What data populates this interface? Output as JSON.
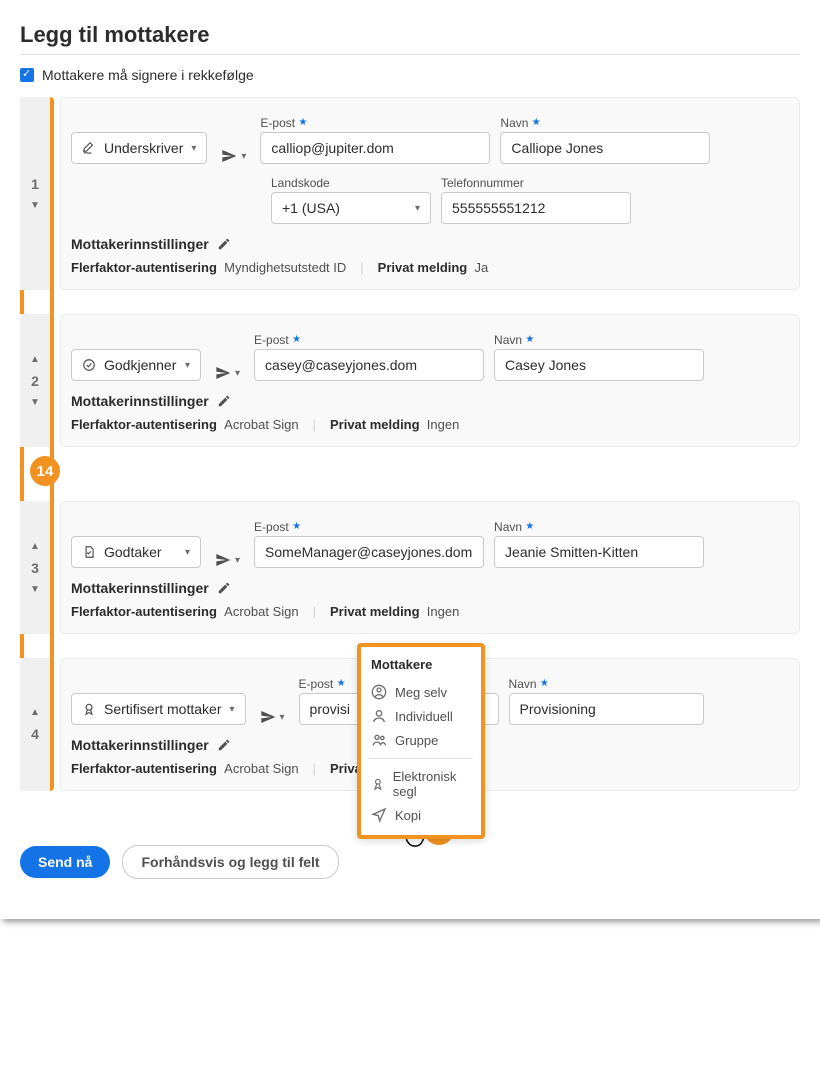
{
  "page_title": "Legg til mottakere",
  "sign_order_checkbox_label": "Mottakere må signere i rekkefølge",
  "sign_order_checked": true,
  "labels": {
    "email": "E-post",
    "name": "Navn",
    "country_code": "Landskode",
    "phone": "Telefonnummer",
    "recipient_settings": "Mottakerinnstillinger",
    "mfa": "Flerfaktor-autentisering",
    "private_msg": "Privat melding"
  },
  "roles": {
    "signer": "Underskriver",
    "approver": "Godkjenner",
    "acceptor": "Godtaker",
    "certified": "Sertifisert mottaker"
  },
  "recipients": [
    {
      "order": "1",
      "role_key": "signer",
      "email": "calliop@jupiter.dom",
      "name": "Calliope Jones",
      "country_code": "+1 (USA)",
      "phone": "555555551212",
      "mfa_value": "Myndighetsutstedt ID",
      "private_msg_value": "Ja"
    },
    {
      "order": "2",
      "role_key": "approver",
      "email": "casey@caseyjones.dom",
      "name": "Casey Jones",
      "mfa_value": "Acrobat Sign",
      "private_msg_value": "Ingen"
    },
    {
      "order": "3",
      "role_key": "acceptor",
      "email": "SomeManager@caseyjones.dom",
      "name": "Jeanie Smitten-Kitten",
      "mfa_value": "Acrobat Sign",
      "private_msg_value": "Ingen"
    },
    {
      "order": "4",
      "role_key": "certified",
      "email_partial": "provisi",
      "name": "Provisioning",
      "mfa_value": "Acrobat Sign",
      "private_msg_partial": "Privat meldi"
    }
  ],
  "popup": {
    "title": "Mottakere",
    "items": [
      {
        "icon": "user-circle",
        "label": "Meg selv"
      },
      {
        "icon": "person",
        "label": "Individuell"
      },
      {
        "icon": "group",
        "label": "Gruppe"
      }
    ],
    "items2": [
      {
        "icon": "seal",
        "label": "Elektronisk segl"
      },
      {
        "icon": "send",
        "label": "Kopi"
      }
    ]
  },
  "callouts": {
    "c13": "13",
    "c14": "14"
  },
  "footer": {
    "send_now": "Send nå",
    "preview": "Forhåndsvis og legg til felt"
  }
}
